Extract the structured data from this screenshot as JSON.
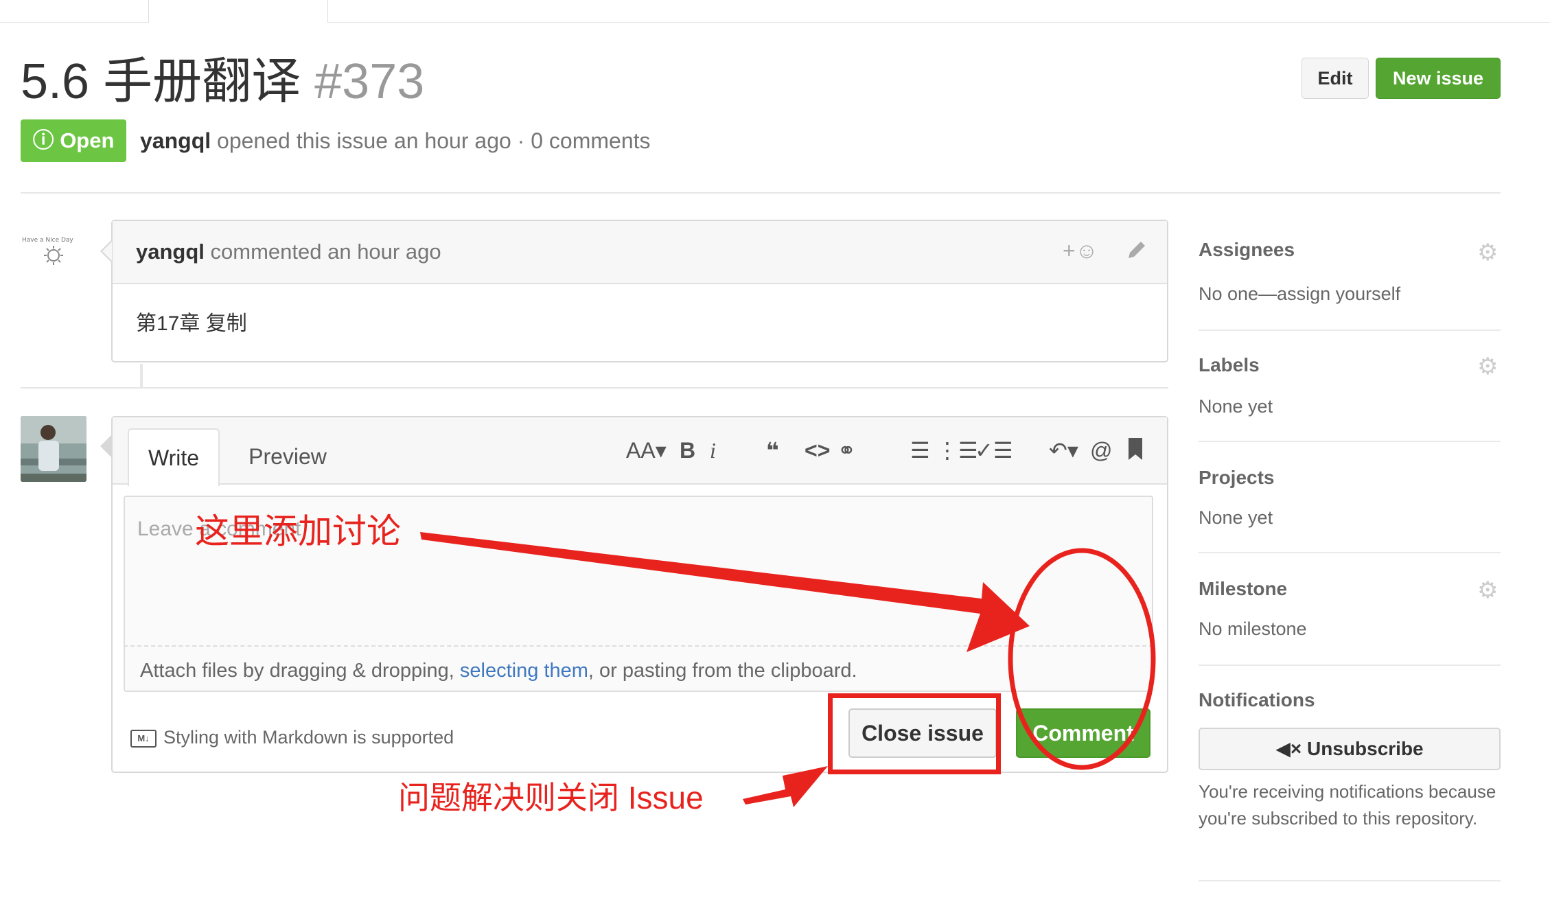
{
  "header": {
    "title": "5.6 手册翻译",
    "number": "#373",
    "edit_label": "Edit",
    "new_issue_label": "New issue"
  },
  "status": {
    "state_icon": "issue-opened-icon",
    "state_label": "Open",
    "author": "yangql",
    "meta_text": " opened this issue an hour ago · 0 comments"
  },
  "comment": {
    "author": "yangql",
    "action_text": " commented an hour ago",
    "reaction_label": "+☺",
    "body": "第17章 复制"
  },
  "editor": {
    "tabs": [
      "Write",
      "Preview"
    ],
    "toolbar": {
      "header": "AA▾",
      "bold": "B",
      "italic": "i",
      "quote": "❝",
      "code": "<>",
      "link": "⚭",
      "bulleted_list": "☰",
      "numbered_list": "⋮☰",
      "task_list": "✓☰",
      "reply": "↶▾",
      "mention": "@",
      "saved_reply": "🔖"
    },
    "placeholder": "Leave a comment",
    "attach_before": "Attach files by dragging & dropping, ",
    "attach_link": "selecting them",
    "attach_after": ", or pasting from the clipboard.",
    "markdown_badge": "M↓",
    "markdown_note": "Styling with Markdown is supported",
    "close_label": "Close issue",
    "comment_label": "Comment"
  },
  "sidebar": {
    "sections": [
      {
        "title": "Assignees",
        "value": "No one—assign yourself"
      },
      {
        "title": "Labels",
        "value": "None yet"
      },
      {
        "title": "Projects",
        "value": "None yet"
      },
      {
        "title": "Milestone",
        "value": "No milestone"
      },
      {
        "title": "Notifications",
        "value": ""
      }
    ],
    "unsubscribe_label": "Unsubscribe",
    "notification_text": "You're receiving notifications because you're subscribed to this repository."
  },
  "annotations": {
    "add_discussion": "这里添加讨论",
    "close_hint": "问题解决则关闭 Issue",
    "color": "#e8231e"
  },
  "colors": {
    "green": "#6cc644",
    "button_green": "#55a532",
    "link_blue": "#4078c0"
  }
}
